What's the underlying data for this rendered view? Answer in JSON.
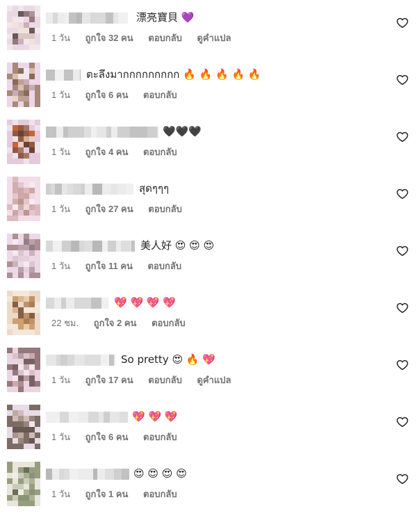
{
  "colors": {
    "text": "#262626",
    "meta": "#737373",
    "background": "#ffffff"
  },
  "comments": [
    {
      "text": "漂亮寶貝 💜",
      "time": "1 วัน",
      "likes": "ถูกใจ 32 คน",
      "reply": "ตอบกลับ",
      "translate": "ดูคำแปล"
    },
    {
      "text": "ตะลึงมากกกกกกกกก 🔥 🔥 🔥 🔥 🔥",
      "time": "1 วัน",
      "likes": "ถูกใจ 6 คน",
      "reply": "ตอบกลับ"
    },
    {
      "text": "🖤🖤🖤",
      "time": "1 วัน",
      "likes": "ถูกใจ 4 คน",
      "reply": "ตอบกลับ"
    },
    {
      "text": "สุดๆๆๆ",
      "time": "1 วัน",
      "likes": "ถูกใจ 27 คน",
      "reply": "ตอบกลับ"
    },
    {
      "text": "美人好 😍 😍 😍",
      "time": "1 วัน",
      "likes": "ถูกใจ 11 คน",
      "reply": "ตอบกลับ"
    },
    {
      "text": "💖 💖 💖 💖",
      "time": "22 ชม.",
      "likes": "ถูกใจ 2 คน",
      "reply": "ตอบกลับ"
    },
    {
      "text": "So pretty 😍 🔥 💖",
      "time": "1 วัน",
      "likes": "ถูกใจ 17 คน",
      "reply": "ตอบกลับ",
      "translate": "ดูคำแปล"
    },
    {
      "text": "💖 💖 💖",
      "time": "1 วัน",
      "likes": "ถูกใจ 6 คน",
      "reply": "ตอบกลับ"
    },
    {
      "text": "😍 😍 😍 😍",
      "time": "1 วัน",
      "likes": "ถูกใจ 1 คน",
      "reply": "ตอบกลับ"
    }
  ],
  "icons": {
    "like": "heart-outline-icon"
  }
}
